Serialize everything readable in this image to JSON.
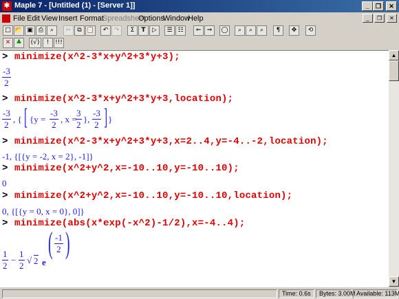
{
  "window": {
    "title": "Maple 7 - [Untitled (1) - [Server 1]]",
    "app_icon": "maple-leaf-icon",
    "title_color": "#0a246a"
  },
  "menu": [
    "File",
    "Edit",
    "View",
    "Insert",
    "Format",
    "Spreadsheet",
    "Options",
    "Window",
    "Help"
  ],
  "menu_disabled": [
    "Spreadsheet"
  ],
  "toolbar1": [
    "new-icon",
    "open-icon",
    "save-icon",
    "print-icon",
    "print-preview-icon",
    "cut-icon",
    "copy-icon",
    "paste-icon",
    "undo-icon",
    "redo-icon",
    "sigma-icon",
    "text-T-icon",
    "prompt-icon",
    "collapse-section-icon",
    "expand-section-icon",
    "back-icon",
    "forward-icon",
    "stop-icon",
    "zoom-100-icon",
    "zoom-150-icon",
    "zoom-200-icon",
    "paragraph-icon",
    "expression-icon",
    "restart-icon"
  ],
  "toolbar2": {
    "math_btn": "(√)",
    "bang_btn": "!",
    "triple_bang_btn": "!!!"
  },
  "worksheet": {
    "cmd1": "minimize(x^2-3*x+y^2+3*y+3);",
    "out1": {
      "num": "-3",
      "den": "2"
    },
    "cmd2": "minimize(x^2-3*x+y^2+3*y+3,location);",
    "out2": {
      "a_num": "-3",
      "a_den": "2",
      "sep": ", {",
      "y_eq": "{y =",
      "y_num": "-3",
      "y_den": "2",
      "x_eq": ", x =",
      "x_num": "3",
      "x_den": "2",
      "close1": "},",
      "v_num": "-3",
      "v_den": "2",
      "end": "}"
    },
    "cmd3": "minimize(x^2-3*x+y^2+3*y+3,x=2..4,y=-4..-2,location);",
    "out3": "-1, {[{y = -2, x = 2}, -1]}",
    "cmd4": "minimize(x^2+y^2,x=-10..10,y=-10..10);",
    "out4": "0",
    "cmd5": "minimize(x^2+y^2,x=-10..10,y=-10..10,location);",
    "out5": "0, {[{y = 0, x = 0}, 0]}",
    "cmd6": "minimize(abs(x*exp(-x^2)-1/2),x=-4..4);",
    "out6": {
      "h_num": "1",
      "h_den": "2",
      "minus": "−",
      "c_num": "1",
      "c_den": "2",
      "sqrt_arg": "2",
      "e": "e",
      "p_num": "-1",
      "p_den": "2"
    },
    "prompt": ">",
    "command_color": "#e00000",
    "output_color": "#1a1aff"
  },
  "status": {
    "time": "Time:  0.6s",
    "bytes": "Bytes: 3.00M",
    "available": "Available: 113M"
  }
}
